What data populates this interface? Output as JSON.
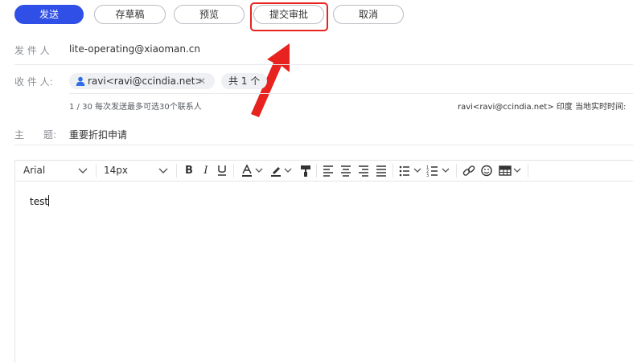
{
  "toolbar": {
    "send_label": "发送",
    "draft_label": "存草稿",
    "preview_label": "预览",
    "submit_label": "提交审批",
    "cancel_label": "取消"
  },
  "sender": {
    "label": "发 件 人",
    "value": "lite-operating@xiaoman.cn"
  },
  "recipient": {
    "label": "收 件 人:",
    "chip": "ravi<ravi@ccindia.net>",
    "count": "共 1 个",
    "limit_note": "1 / 30 每次发送最多可选30个联系人",
    "local_time_note": "ravi<ravi@ccindia.net> 印度 当地实时时间:"
  },
  "subject": {
    "label": "主　　题:",
    "value": "重要折扣申请"
  },
  "editor_toolbar": {
    "font": "Arial",
    "size": "14px"
  },
  "editor": {
    "body": "test"
  },
  "colors": {
    "primary": "#2f4fe6",
    "annotation": "#e8221f"
  }
}
